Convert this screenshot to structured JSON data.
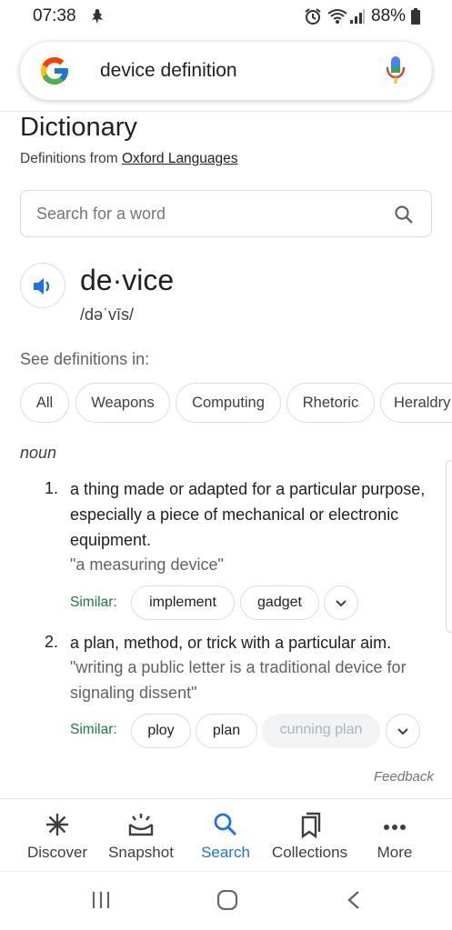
{
  "status_bar": {
    "time": "07:38",
    "battery": "88%"
  },
  "search": {
    "query": "device definition"
  },
  "dictionary": {
    "title": "Dictionary",
    "source_prefix": "Definitions from",
    "source_link": "Oxford Languages",
    "word_search_placeholder": "Search for a word",
    "headword": "de·vice",
    "phonetic": "/dəˈvīs/",
    "see_definitions_label": "See definitions in:",
    "domain_chips": [
      "All",
      "Weapons",
      "Computing",
      "Rhetoric",
      "Heraldry"
    ],
    "part_of_speech": "noun",
    "senses": [
      {
        "number": "1.",
        "definition": "a thing made or adapted for a particular purpose, especially a piece of mechanical or electronic equipment.",
        "example": "\"a measuring device\"",
        "similar_label": "Similar:",
        "similar": [
          "implement",
          "gadget"
        ]
      },
      {
        "number": "2.",
        "definition": "a plan, method, or trick with a particular aim.",
        "example": "\"writing a public letter is a traditional device for signaling dissent\"",
        "similar_label": "Similar:",
        "similar": [
          "ploy",
          "plan",
          "cunning plan"
        ]
      }
    ],
    "feedback": "Feedback"
  },
  "bottom_nav": {
    "items": [
      {
        "label": "Discover",
        "icon": "asterisk-icon"
      },
      {
        "label": "Snapshot",
        "icon": "snapshot-icon"
      },
      {
        "label": "Search",
        "icon": "search-icon",
        "active": true
      },
      {
        "label": "Collections",
        "icon": "bookmarks-icon"
      },
      {
        "label": "More",
        "icon": "more-dots-icon"
      }
    ]
  },
  "colors": {
    "accent": "#1a73e8",
    "similar_green": "#188038"
  }
}
